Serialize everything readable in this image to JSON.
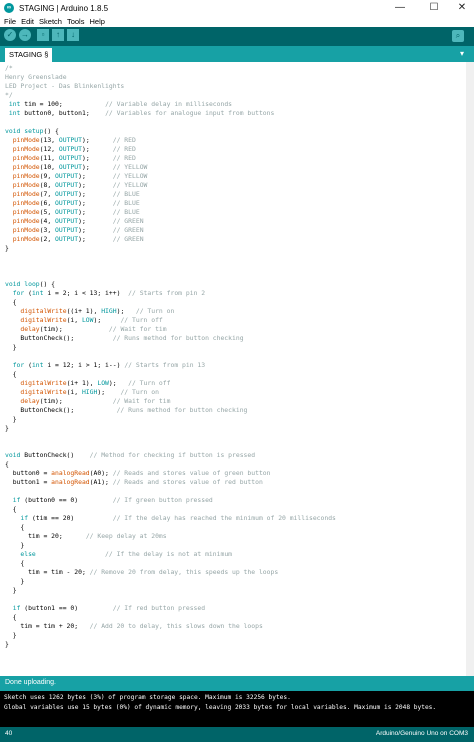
{
  "window": {
    "title": "STAGING | Arduino 1.8.5",
    "icon_text": "∞",
    "minimize": "—",
    "maximize": "☐",
    "close": "✕"
  },
  "menu": [
    "File",
    "Edit",
    "Sketch",
    "Tools",
    "Help"
  ],
  "toolbar": {
    "verify": "✓",
    "upload": "→",
    "new": "▫",
    "open": "↑",
    "save": "↓",
    "monitor": "⌕"
  },
  "tabs": {
    "active": "STAGING §",
    "menu": "▾"
  },
  "code_lines": [
    [
      [
        "c",
        "/*"
      ]
    ],
    [
      [
        "c",
        "Henry Greenslade"
      ]
    ],
    [
      [
        "c",
        "LED Project - Das Blinkenlights"
      ]
    ],
    [
      [
        "c",
        "*/"
      ]
    ],
    [
      [
        "n",
        " "
      ],
      [
        "t",
        "int"
      ],
      [
        "n",
        " tim = 100;           "
      ],
      [
        "c",
        "// Variable delay in milliseconds"
      ]
    ],
    [
      [
        "n",
        " "
      ],
      [
        "t",
        "int"
      ],
      [
        "n",
        " button0, button1;    "
      ],
      [
        "c",
        "// Variables for analogue input from buttons"
      ]
    ],
    [],
    [
      [
        "t",
        "void"
      ],
      [
        "n",
        " "
      ],
      [
        "k",
        "setup"
      ],
      [
        "n",
        "() {"
      ]
    ],
    [
      [
        "n",
        "  "
      ],
      [
        "f",
        "pinMode"
      ],
      [
        "n",
        "(13, "
      ],
      [
        "t",
        "OUTPUT"
      ],
      [
        "n",
        ");      "
      ],
      [
        "c",
        "// RED"
      ]
    ],
    [
      [
        "n",
        "  "
      ],
      [
        "f",
        "pinMode"
      ],
      [
        "n",
        "(12, "
      ],
      [
        "t",
        "OUTPUT"
      ],
      [
        "n",
        ");      "
      ],
      [
        "c",
        "// RED"
      ]
    ],
    [
      [
        "n",
        "  "
      ],
      [
        "f",
        "pinMode"
      ],
      [
        "n",
        "(11, "
      ],
      [
        "t",
        "OUTPUT"
      ],
      [
        "n",
        ");      "
      ],
      [
        "c",
        "// RED"
      ]
    ],
    [
      [
        "n",
        "  "
      ],
      [
        "f",
        "pinMode"
      ],
      [
        "n",
        "(10, "
      ],
      [
        "t",
        "OUTPUT"
      ],
      [
        "n",
        ");      "
      ],
      [
        "c",
        "// YELLOW"
      ]
    ],
    [
      [
        "n",
        "  "
      ],
      [
        "f",
        "pinMode"
      ],
      [
        "n",
        "(9, "
      ],
      [
        "t",
        "OUTPUT"
      ],
      [
        "n",
        ");       "
      ],
      [
        "c",
        "// YELLOW"
      ]
    ],
    [
      [
        "n",
        "  "
      ],
      [
        "f",
        "pinMode"
      ],
      [
        "n",
        "(8, "
      ],
      [
        "t",
        "OUTPUT"
      ],
      [
        "n",
        ");       "
      ],
      [
        "c",
        "// YELLOW"
      ]
    ],
    [
      [
        "n",
        "  "
      ],
      [
        "f",
        "pinMode"
      ],
      [
        "n",
        "(7, "
      ],
      [
        "t",
        "OUTPUT"
      ],
      [
        "n",
        ");       "
      ],
      [
        "c",
        "// BLUE"
      ]
    ],
    [
      [
        "n",
        "  "
      ],
      [
        "f",
        "pinMode"
      ],
      [
        "n",
        "(6, "
      ],
      [
        "t",
        "OUTPUT"
      ],
      [
        "n",
        ");       "
      ],
      [
        "c",
        "// BLUE"
      ]
    ],
    [
      [
        "n",
        "  "
      ],
      [
        "f",
        "pinMode"
      ],
      [
        "n",
        "(5, "
      ],
      [
        "t",
        "OUTPUT"
      ],
      [
        "n",
        ");       "
      ],
      [
        "c",
        "// BLUE"
      ]
    ],
    [
      [
        "n",
        "  "
      ],
      [
        "f",
        "pinMode"
      ],
      [
        "n",
        "(4, "
      ],
      [
        "t",
        "OUTPUT"
      ],
      [
        "n",
        ");       "
      ],
      [
        "c",
        "// GREEN"
      ]
    ],
    [
      [
        "n",
        "  "
      ],
      [
        "f",
        "pinMode"
      ],
      [
        "n",
        "(3, "
      ],
      [
        "t",
        "OUTPUT"
      ],
      [
        "n",
        ");       "
      ],
      [
        "c",
        "// GREEN"
      ]
    ],
    [
      [
        "n",
        "  "
      ],
      [
        "f",
        "pinMode"
      ],
      [
        "n",
        "(2, "
      ],
      [
        "t",
        "OUTPUT"
      ],
      [
        "n",
        ");       "
      ],
      [
        "c",
        "// GREEN"
      ]
    ],
    [
      [
        "n",
        "}"
      ]
    ],
    [],
    [],
    [],
    [
      [
        "t",
        "void"
      ],
      [
        "n",
        " "
      ],
      [
        "k",
        "loop"
      ],
      [
        "n",
        "() {"
      ]
    ],
    [
      [
        "n",
        "  "
      ],
      [
        "k",
        "for"
      ],
      [
        "n",
        " ("
      ],
      [
        "t",
        "int"
      ],
      [
        "n",
        " i = 2; i < 13; i++)  "
      ],
      [
        "c",
        "// Starts from pin 2"
      ]
    ],
    [
      [
        "n",
        "  {"
      ]
    ],
    [
      [
        "n",
        "    "
      ],
      [
        "f",
        "digitalWrite"
      ],
      [
        "n",
        "((i+ 1), "
      ],
      [
        "t",
        "HIGH"
      ],
      [
        "n",
        ");   "
      ],
      [
        "c",
        "// Turn on"
      ]
    ],
    [
      [
        "n",
        "    "
      ],
      [
        "f",
        "digitalWrite"
      ],
      [
        "n",
        "(i, "
      ],
      [
        "t",
        "LOW"
      ],
      [
        "n",
        ");     "
      ],
      [
        "c",
        "// Turn off"
      ]
    ],
    [
      [
        "n",
        "    "
      ],
      [
        "f",
        "delay"
      ],
      [
        "n",
        "(tim);            "
      ],
      [
        "c",
        "// Wait for tim"
      ]
    ],
    [
      [
        "n",
        "    ButtonCheck();          "
      ],
      [
        "c",
        "// Runs method for button checking"
      ]
    ],
    [
      [
        "n",
        "  }"
      ]
    ],
    [],
    [
      [
        "n",
        "  "
      ],
      [
        "k",
        "for"
      ],
      [
        "n",
        " ("
      ],
      [
        "t",
        "int"
      ],
      [
        "n",
        " i = 12; i > 1; i--) "
      ],
      [
        "c",
        "// Starts from pin 13"
      ]
    ],
    [
      [
        "n",
        "  {"
      ]
    ],
    [
      [
        "n",
        "    "
      ],
      [
        "f",
        "digitalWrite"
      ],
      [
        "n",
        "(i+ 1), "
      ],
      [
        "t",
        "LOW"
      ],
      [
        "n",
        ");   "
      ],
      [
        "c",
        "// Turn off"
      ]
    ],
    [
      [
        "n",
        "    "
      ],
      [
        "f",
        "digitalWrite"
      ],
      [
        "n",
        "(i, "
      ],
      [
        "t",
        "HIGH"
      ],
      [
        "n",
        ");    "
      ],
      [
        "c",
        "// Turn on"
      ]
    ],
    [
      [
        "n",
        "    "
      ],
      [
        "f",
        "delay"
      ],
      [
        "n",
        "(tim);             "
      ],
      [
        "c",
        "// Wait for tim"
      ]
    ],
    [
      [
        "n",
        "    ButtonCheck();           "
      ],
      [
        "c",
        "// Runs method for button checking"
      ]
    ],
    [
      [
        "n",
        "  }"
      ]
    ],
    [
      [
        "n",
        "}"
      ]
    ],
    [],
    [],
    [
      [
        "t",
        "void"
      ],
      [
        "n",
        " ButtonCheck()    "
      ],
      [
        "c",
        "// Method for checking if button is pressed"
      ]
    ],
    [
      [
        "n",
        "{"
      ]
    ],
    [
      [
        "n",
        "  button0 = "
      ],
      [
        "f",
        "analogRead"
      ],
      [
        "n",
        "(A0); "
      ],
      [
        "c",
        "// Reads and stores value of green button"
      ]
    ],
    [
      [
        "n",
        "  button1 = "
      ],
      [
        "f",
        "analogRead"
      ],
      [
        "n",
        "(A1); "
      ],
      [
        "c",
        "// Reads and stores value of red button"
      ]
    ],
    [],
    [
      [
        "n",
        "  "
      ],
      [
        "k",
        "if"
      ],
      [
        "n",
        " (button0 == 0)         "
      ],
      [
        "c",
        "// If green button pressed"
      ]
    ],
    [
      [
        "n",
        "  {"
      ]
    ],
    [
      [
        "n",
        "    "
      ],
      [
        "k",
        "if"
      ],
      [
        "n",
        " (tim == 20)          "
      ],
      [
        "c",
        "// If the delay has reached the minimum of 20 milliseconds"
      ]
    ],
    [
      [
        "n",
        "    {"
      ]
    ],
    [
      [
        "n",
        "      tim = 20;      "
      ],
      [
        "c",
        "// Keep delay at 20ms"
      ]
    ],
    [
      [
        "n",
        "    }"
      ]
    ],
    [
      [
        "n",
        "    "
      ],
      [
        "k",
        "else"
      ],
      [
        "n",
        "                  "
      ],
      [
        "c",
        "// If the delay is not at minimum"
      ]
    ],
    [
      [
        "n",
        "    {"
      ]
    ],
    [
      [
        "n",
        "      tim = tim - 20; "
      ],
      [
        "c",
        "// Remove 20 from delay, this speeds up the loops"
      ]
    ],
    [
      [
        "n",
        "    }"
      ]
    ],
    [
      [
        "n",
        "  }"
      ]
    ],
    [],
    [
      [
        "n",
        "  "
      ],
      [
        "k",
        "if"
      ],
      [
        "n",
        " (button1 == 0)         "
      ],
      [
        "c",
        "// If red button pressed"
      ]
    ],
    [
      [
        "n",
        "  {"
      ]
    ],
    [
      [
        "n",
        "    tim = tim + 20;   "
      ],
      [
        "c",
        "// Add 20 to delay, this slows down the loops"
      ]
    ],
    [
      [
        "n",
        "  }"
      ]
    ],
    [
      [
        "n",
        "}"
      ]
    ]
  ],
  "status": {
    "message": "Done uploading."
  },
  "console": {
    "line1": "Sketch uses 1262 bytes (3%) of program storage space. Maximum is 32256 bytes.",
    "line2": "Global variables use 15 bytes (0%) of dynamic memory, leaving 2033 bytes for local variables. Maximum is 2048 bytes."
  },
  "footer": {
    "line": "40",
    "board": "Arduino/Genuino Uno on COM3"
  }
}
